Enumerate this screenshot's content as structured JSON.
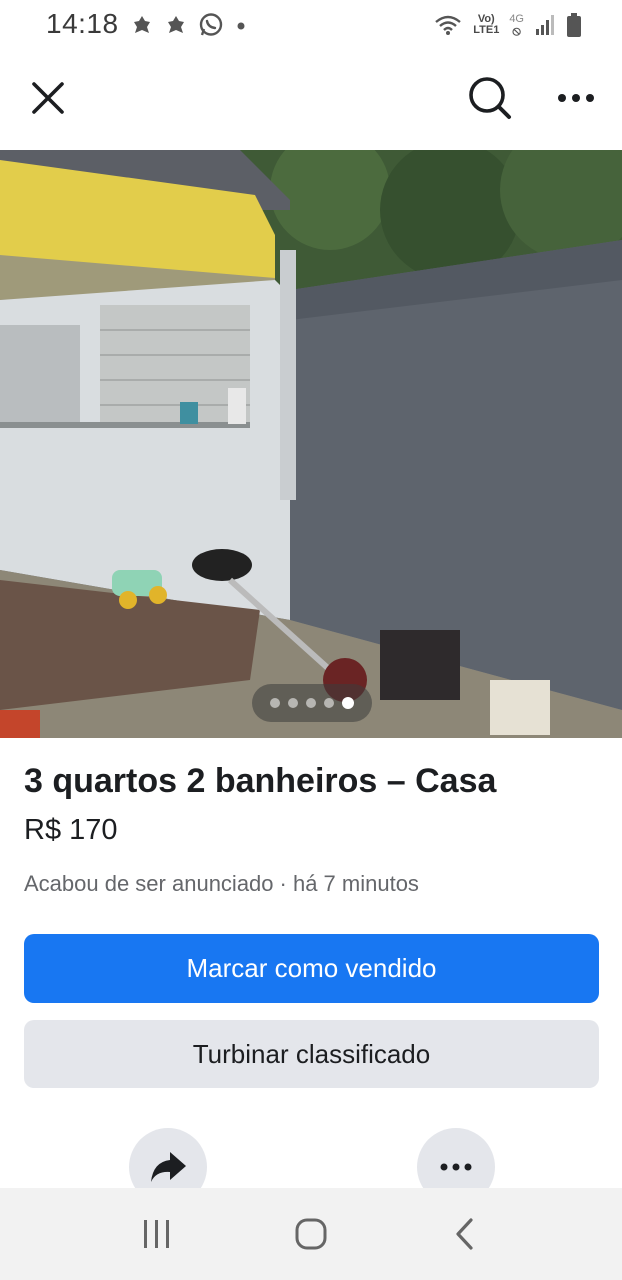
{
  "status_bar": {
    "time": "14:18",
    "left_icons": [
      "notification-icon",
      "notification-icon",
      "whatsapp-icon",
      "dot-icon"
    ],
    "network_top": "Vo)",
    "network_bottom": "LTE1",
    "network_type": "4G",
    "right_icons": [
      "wifi-icon",
      "signal-icon",
      "battery-icon"
    ]
  },
  "app_bar": {
    "icons": [
      "close-icon",
      "search-icon",
      "more-horizontal-icon"
    ]
  },
  "photo": {
    "pager_total": 5,
    "pager_active": 5
  },
  "listing": {
    "title": "3 quartos 2 banheiros – Casa",
    "price": "R$ 170",
    "status": "Acabou de ser anunciado",
    "time_ago": "· há 7 minutos"
  },
  "actions": {
    "primary_label": "Marcar como vendido",
    "secondary_label": "Turbinar classificado",
    "round_icons": [
      "share-icon",
      "more-horizontal-icon"
    ]
  },
  "nav_bar": {
    "icons": [
      "recent-apps-icon",
      "home-icon",
      "back-icon"
    ]
  },
  "colors": {
    "accent": "#1877f2",
    "secondary_button": "#e4e6eb",
    "meta_text": "#65676b"
  }
}
